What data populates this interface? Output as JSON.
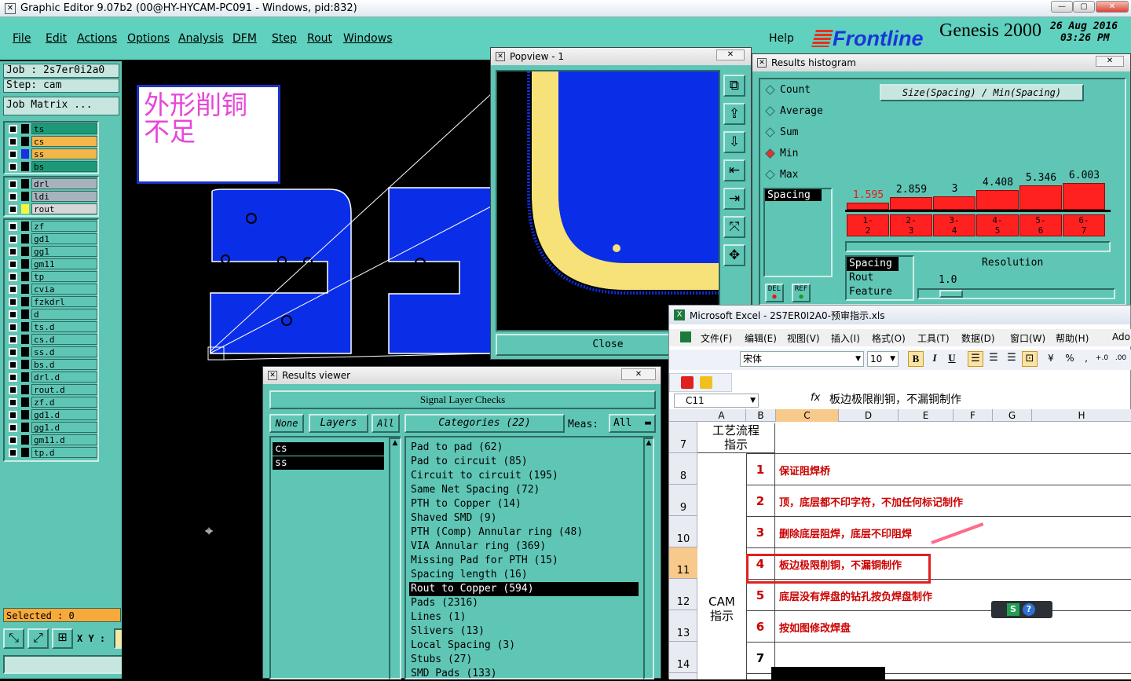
{
  "main_title": "Graphic Editor 9.07b2 (00@HY-HYCAM-PC091 - Windows, pid:832)",
  "menu": [
    "File",
    "Edit",
    "Actions",
    "Options",
    "Analysis",
    "DFM",
    "Step",
    "Rout",
    "Windows"
  ],
  "help": "Help",
  "brand": "Frontline",
  "product": "Genesis 2000",
  "date": "26 Aug 2016",
  "time": "03:26 PM",
  "job": "Job  : 2s7er0i2a0",
  "step": "Step: cam",
  "job_matrix": "Job Matrix ...",
  "layers_top": [
    "ts",
    "cs",
    "ss",
    "bs"
  ],
  "layers_mid": [
    "drl",
    "ldi",
    "rout"
  ],
  "layers_bot": [
    "zf",
    "gd1",
    "gg1",
    "gm11",
    "tp",
    "cvia",
    "fzkdrl",
    "d",
    "ts.d",
    "cs.d",
    "ss.d",
    "bs.d",
    "drl.d",
    "rout.d",
    "zf.d",
    "gd1.d",
    "gg1.d",
    "gm11.d",
    "tp.d"
  ],
  "selected": "Selected : 0",
  "xy_label": "X Y :",
  "annotation_note": "外形削铜\n不足",
  "popview": {
    "title": "Popview - 1",
    "close": "Close"
  },
  "histogram": {
    "title": "Results histogram",
    "header": "Size(Spacing) / Min(Spacing)",
    "options": [
      "Count",
      "Average",
      "Sum",
      "Min",
      "Max"
    ],
    "selected_option": "Min",
    "values": [
      "1.595",
      "2.859",
      "3",
      "4.408",
      "5.346",
      "6.003"
    ],
    "bins": [
      "1-\n2",
      "2-\n3",
      "3-\n4",
      "4-\n5",
      "5-\n6",
      "6-\n7"
    ],
    "list1": [
      "Spacing"
    ],
    "list2": [
      "Spacing",
      "Rout",
      "Feature"
    ],
    "resolution_label": "Resolution",
    "resolution_value": "1.0",
    "del": "DEL",
    "ref": "REF"
  },
  "results_viewer": {
    "title": "Results viewer",
    "header": "Signal Layer Checks",
    "none": "None",
    "layers": "Layers",
    "all": "All",
    "categories_label": "Categories (22)",
    "meas_label": "Meas:",
    "meas_value": "All",
    "layer_list": [
      "cs",
      "ss"
    ],
    "categories": [
      "Pad to pad (62)",
      "Pad to circuit (85)",
      "Circuit to circuit (195)",
      "Same Net Spacing (72)",
      "PTH to Copper (14)",
      "Shaved SMD (9)",
      "PTH (Comp) Annular ring (48)",
      "VIA Annular ring (369)",
      "Missing Pad for PTH (15)",
      "Spacing length (16)",
      "Rout to Copper (594)",
      "Pads (2316)",
      "Lines (1)",
      "Slivers (13)",
      "Local Spacing (3)",
      "Stubs (27)",
      "SMD Pads (133)"
    ],
    "selected_category": "Rout to Copper (594)"
  },
  "excel": {
    "title": "Microsoft Excel - 2S7ER0I2A0-预审指示.xls",
    "menus": [
      "文件(F)",
      "编辑(E)",
      "视图(V)",
      "插入(I)",
      "格式(O)",
      "工具(T)",
      "数据(D)",
      "窗口(W)",
      "帮助(H)",
      "Adobe"
    ],
    "font": "宋体",
    "size": "10",
    "cell_ref": "C11",
    "formula": "板边极限削铜，不漏铜制作",
    "columns": [
      "A",
      "B",
      "C",
      "D",
      "E",
      "F",
      "G",
      "H"
    ],
    "row_numbers": [
      "7",
      "8",
      "9",
      "10",
      "11",
      "12",
      "13",
      "14"
    ],
    "section_a": "工艺流程\n指示",
    "section_b": "CAM\n指示",
    "items": [
      {
        "n": "1",
        "text": "保证阻焊桥"
      },
      {
        "n": "2",
        "text": "顶，底层都不印字符，不加任何标记制作"
      },
      {
        "n": "3",
        "text": "删除底层阻焊，底层不印阻焊"
      },
      {
        "n": "4",
        "text": "板边极限削铜，不漏铜制作"
      },
      {
        "n": "5",
        "text": "底层没有焊盘的钻孔按负焊盘制作"
      },
      {
        "n": "6",
        "text": "按如图修改焊盘"
      },
      {
        "n": "7",
        "text": ""
      }
    ]
  },
  "colors": {
    "teal": "#5fc6b5",
    "blue": "#0a2ee8",
    "yellow": "#f7e27a",
    "bar_red": "#ff2020"
  }
}
